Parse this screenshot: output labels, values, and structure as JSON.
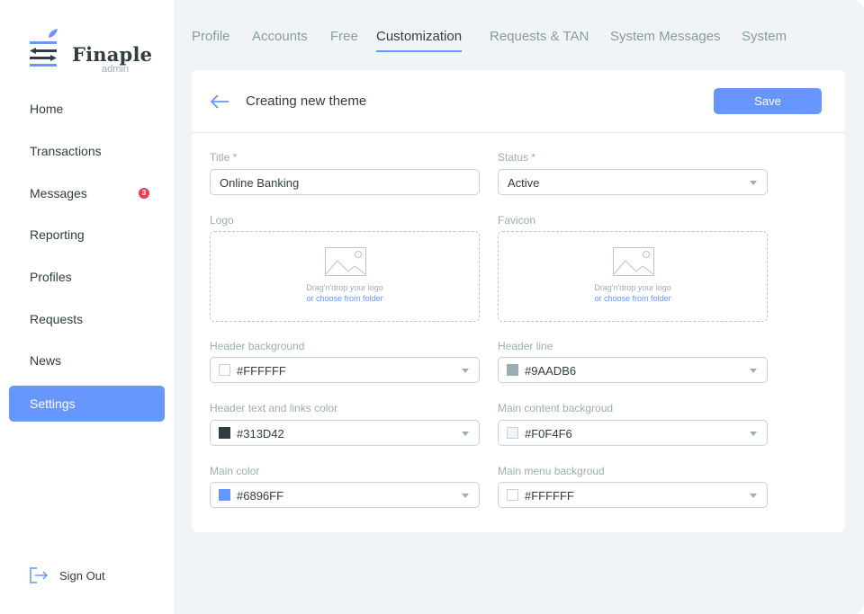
{
  "brand": {
    "name": "Finaple",
    "subtitle": "admin"
  },
  "sidebar": {
    "items": [
      {
        "label": "Home"
      },
      {
        "label": "Transactions"
      },
      {
        "label": "Messages",
        "badge": "3"
      },
      {
        "label": "Reporting"
      },
      {
        "label": "Profiles"
      },
      {
        "label": "Requests"
      },
      {
        "label": "News"
      },
      {
        "label": "Settings",
        "active": true
      }
    ],
    "signout": "Sign Out"
  },
  "tabs": [
    {
      "label": "Profile"
    },
    {
      "label": "Accounts"
    },
    {
      "label": "Free"
    },
    {
      "label": "Customization",
      "active": true
    },
    {
      "label": "Requests & TAN"
    },
    {
      "label": "System Messages"
    },
    {
      "label": "System"
    }
  ],
  "card": {
    "title": "Creating new theme",
    "save_label": "Save"
  },
  "form": {
    "title": {
      "label": "Title *",
      "value": "Online Banking"
    },
    "status": {
      "label": "Status *",
      "value": "Active"
    },
    "logo": {
      "label": "Logo",
      "hint": "Drag'n'drop your logo",
      "link": "or choose from folder"
    },
    "favicon": {
      "label": "Favicon",
      "hint": "Drag'n'drop your logo",
      "link": "or choose from folder"
    },
    "header_background": {
      "label": "Header background",
      "value": "#FFFFFF"
    },
    "header_line": {
      "label": "Header line",
      "value": "#9AADB6"
    },
    "header_text": {
      "label": "Header text and links color",
      "value": "#313D42"
    },
    "main_content_bg": {
      "label": "Main content backgroud",
      "value": "#F0F4F6"
    },
    "main_color": {
      "label": "Main color",
      "value": "#6896FF"
    },
    "main_menu_bg": {
      "label": "Main menu backgroud",
      "value": "#FFFFFF"
    }
  },
  "colors": {
    "accent": "#6896FF",
    "badge": "#EB3E56",
    "text": "#313D42",
    "muted": "#9AADB6"
  }
}
